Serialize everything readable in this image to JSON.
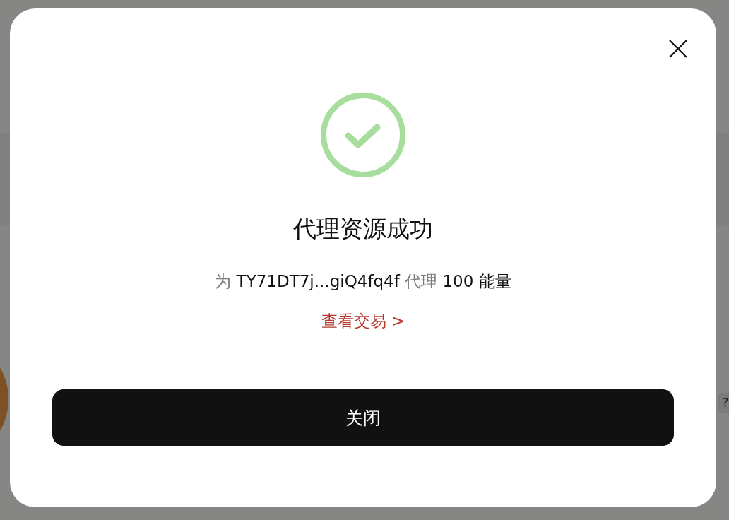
{
  "background": {
    "help_label": "?"
  },
  "dialog": {
    "title": "代理资源成功",
    "message": [
      {
        "kind": "muted",
        "text": "为"
      },
      {
        "kind": "strong",
        "text": "TY71DT7j...giQ4fq4f"
      },
      {
        "kind": "muted",
        "text": "代理"
      },
      {
        "kind": "strong",
        "text": "100 能量"
      }
    ],
    "link": "查看交易 >",
    "button": "关闭"
  }
}
